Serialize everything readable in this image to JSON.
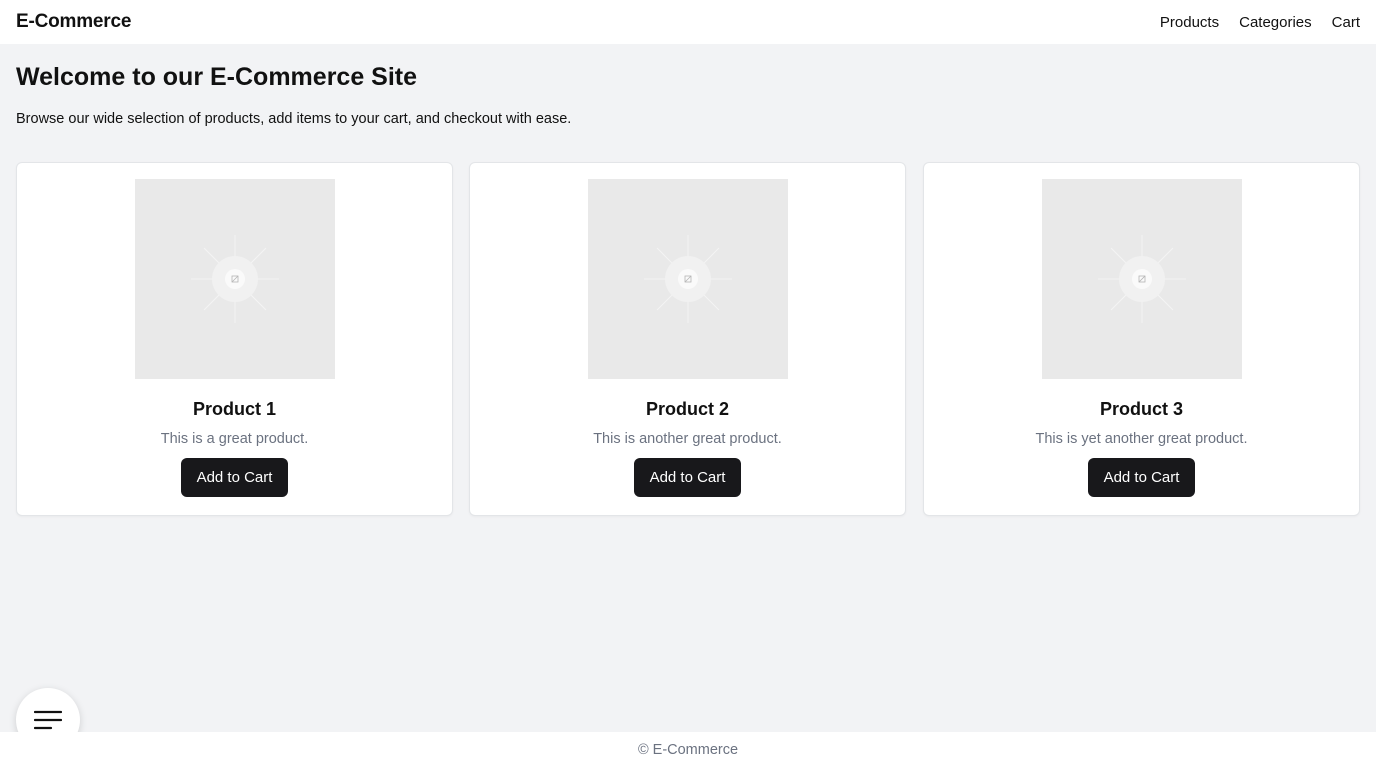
{
  "header": {
    "brand": "E-Commerce",
    "nav": [
      {
        "label": "Products"
      },
      {
        "label": "Categories"
      },
      {
        "label": "Cart"
      }
    ]
  },
  "main": {
    "title": "Welcome to our E-Commerce Site",
    "subtitle": "Browse our wide selection of products, add items to your cart, and checkout with ease."
  },
  "products": [
    {
      "title": "Product 1",
      "description": "This is a great product.",
      "button_label": "Add to Cart",
      "image_icon": "image-placeholder-icon"
    },
    {
      "title": "Product 2",
      "description": "This is another great product.",
      "button_label": "Add to Cart",
      "image_icon": "image-placeholder-icon"
    },
    {
      "title": "Product 3",
      "description": "This is yet another great product.",
      "button_label": "Add to Cart",
      "image_icon": "image-placeholder-icon"
    }
  ],
  "fab": {
    "icon": "menu-icon"
  },
  "footer": {
    "text": "© E-Commerce"
  },
  "colors": {
    "background": "#f2f3f5",
    "surface": "#ffffff",
    "button": "#18181b",
    "muted_text": "#6b7280",
    "image_placeholder": "#e9e9e9"
  }
}
